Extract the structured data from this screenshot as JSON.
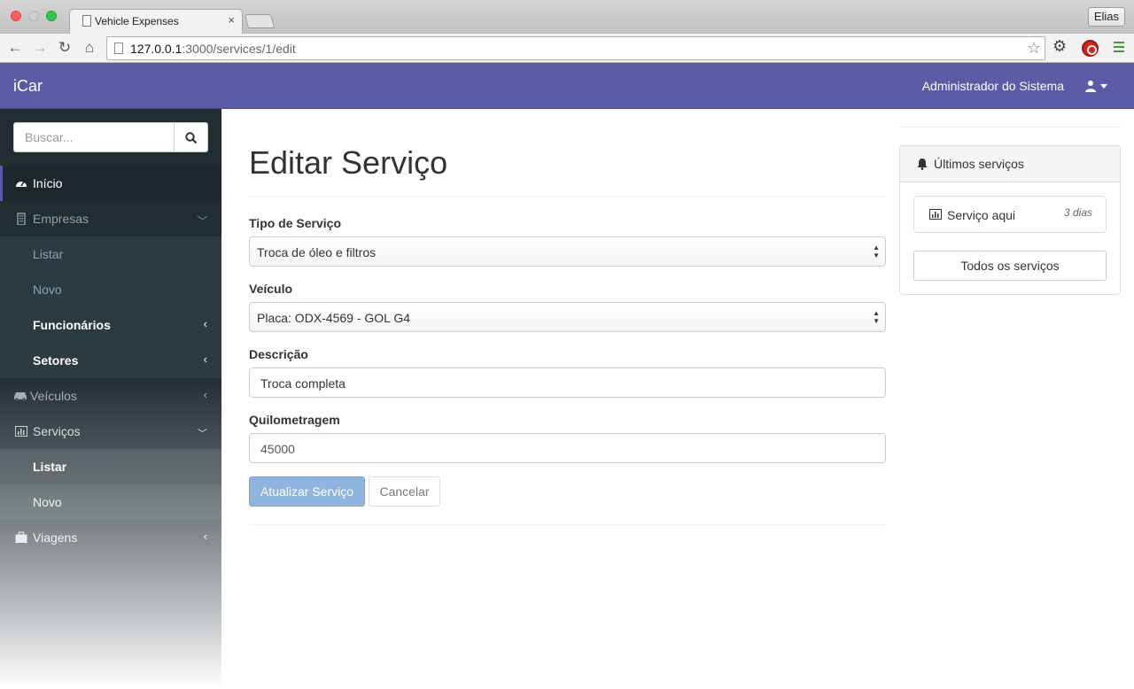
{
  "browser": {
    "tab_title": "Vehicle Expenses",
    "tab_close": "×",
    "profile": "Elias",
    "url_host": "127.0.0.1",
    "url_path": ":3000/services/1/edit"
  },
  "navbar": {
    "brand": "iCar",
    "user": "Administrador do Sistema"
  },
  "sidebar": {
    "search_placeholder": "Buscar...",
    "items": [
      {
        "label": "Início",
        "icon": "dashboard-icon",
        "active": true
      },
      {
        "label": "Empresas",
        "icon": "building-icon",
        "chevron": "down"
      },
      {
        "label": "Listar",
        "sub": true
      },
      {
        "label": "Novo",
        "sub": true
      },
      {
        "label": "Funcionários",
        "sub": true,
        "chevron": "left"
      },
      {
        "label": "Setores",
        "sub": true,
        "chevron": "left"
      },
      {
        "label": "Veículos",
        "icon": "car-icon",
        "chevron": "left"
      },
      {
        "label": "Serviços",
        "icon": "bar-chart-icon",
        "chevron": "down"
      },
      {
        "label": "Listar",
        "sub": true
      },
      {
        "label": "Novo",
        "sub": true
      },
      {
        "label": "Viagens",
        "icon": "briefcase-icon",
        "chevron": "left"
      }
    ]
  },
  "main": {
    "title": "Editar Serviço",
    "fields": {
      "tipo_label": "Tipo de Serviço",
      "tipo_value": "Troca de óleo e filtros",
      "veiculo_label": "Veículo",
      "veiculo_value": "Placa: ODX-4569 - GOL G4",
      "descricao_label": "Descrição",
      "descricao_value": "Troca completa",
      "km_label": "Quilometragem",
      "km_value": "45000"
    },
    "submit_label": "Atualizar Serviço",
    "cancel_label": "Cancelar"
  },
  "panel": {
    "title": "Últimos serviços",
    "item_text": "Serviço aqui",
    "item_time": "3 dias",
    "all_button": "Todos os serviços"
  },
  "colors": {
    "navbar": "#5c5ba6",
    "sidebar": "#222d32",
    "primary_button": "#8fb4df"
  }
}
